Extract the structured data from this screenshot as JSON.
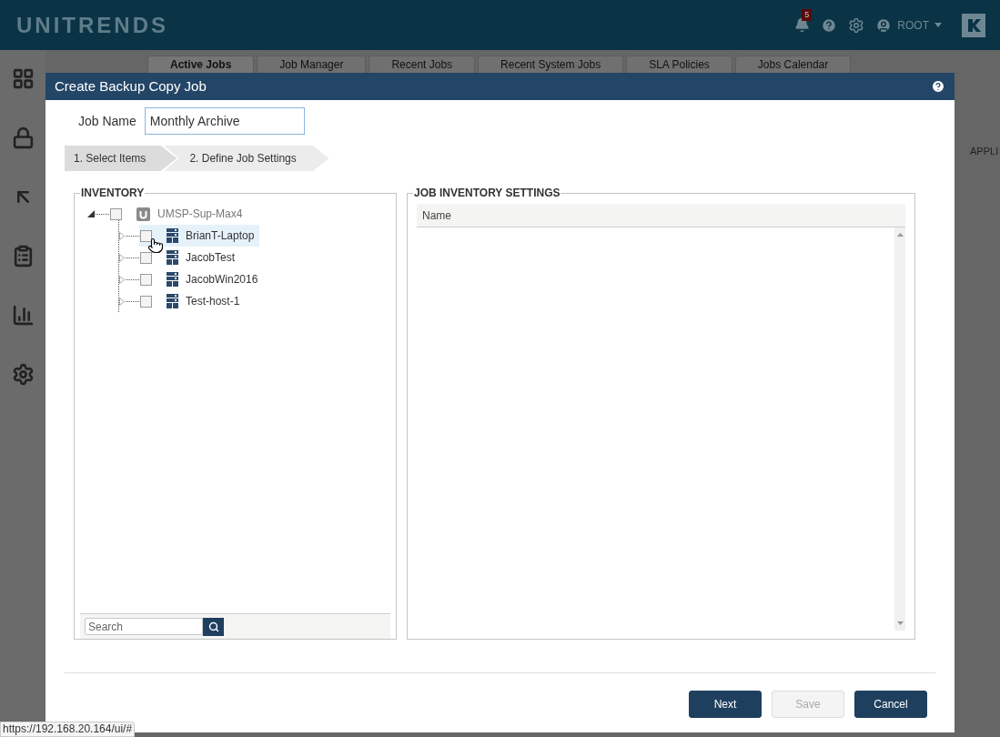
{
  "header": {
    "logo": "UNITRENDS",
    "notifications": "5",
    "user": "ROOT"
  },
  "background_tabs": [
    {
      "label": "Active Jobs",
      "selected": true
    },
    {
      "label": "Job Manager",
      "selected": false
    },
    {
      "label": "Recent Jobs",
      "selected": false
    },
    {
      "label": "Recent System Jobs",
      "selected": false
    },
    {
      "label": "SLA Policies",
      "selected": false
    },
    {
      "label": "Jobs Calendar",
      "selected": false
    }
  ],
  "background_column": "APPLI",
  "dialog": {
    "title": "Create Backup Copy Job",
    "job_name": {
      "label": "Job Name",
      "value": "Monthly Archive"
    },
    "steps": [
      {
        "label": "1. Select Items",
        "selected": true
      },
      {
        "label": "2. Define Job Settings",
        "selected": false
      }
    ],
    "inventory": {
      "title": "INVENTORY",
      "tree": [
        {
          "label": "UMSP-Sup-Max4",
          "kind": "appliance",
          "expanded": true,
          "checked": false,
          "selected": false,
          "children": [
            {
              "label": "BrianT-Laptop",
              "kind": "asset",
              "expanded": false,
              "checked": false,
              "selected": true
            },
            {
              "label": "JacobTest",
              "kind": "asset",
              "expanded": false,
              "checked": false,
              "selected": false
            },
            {
              "label": "JacobWin2016",
              "kind": "asset",
              "expanded": false,
              "checked": false,
              "selected": false
            },
            {
              "label": "Test-host-1",
              "kind": "asset",
              "expanded": false,
              "checked": false,
              "selected": false
            }
          ]
        }
      ],
      "search": {
        "placeholder": "Search"
      }
    },
    "settings": {
      "title": "JOB INVENTORY SETTINGS",
      "columns": [
        "Name"
      ]
    },
    "buttons": [
      {
        "label": "Next",
        "disabled": false
      },
      {
        "label": "Save",
        "disabled": true
      },
      {
        "label": "Cancel",
        "disabled": false
      }
    ]
  },
  "status_url": "https://192.168.20.164/ui/#"
}
